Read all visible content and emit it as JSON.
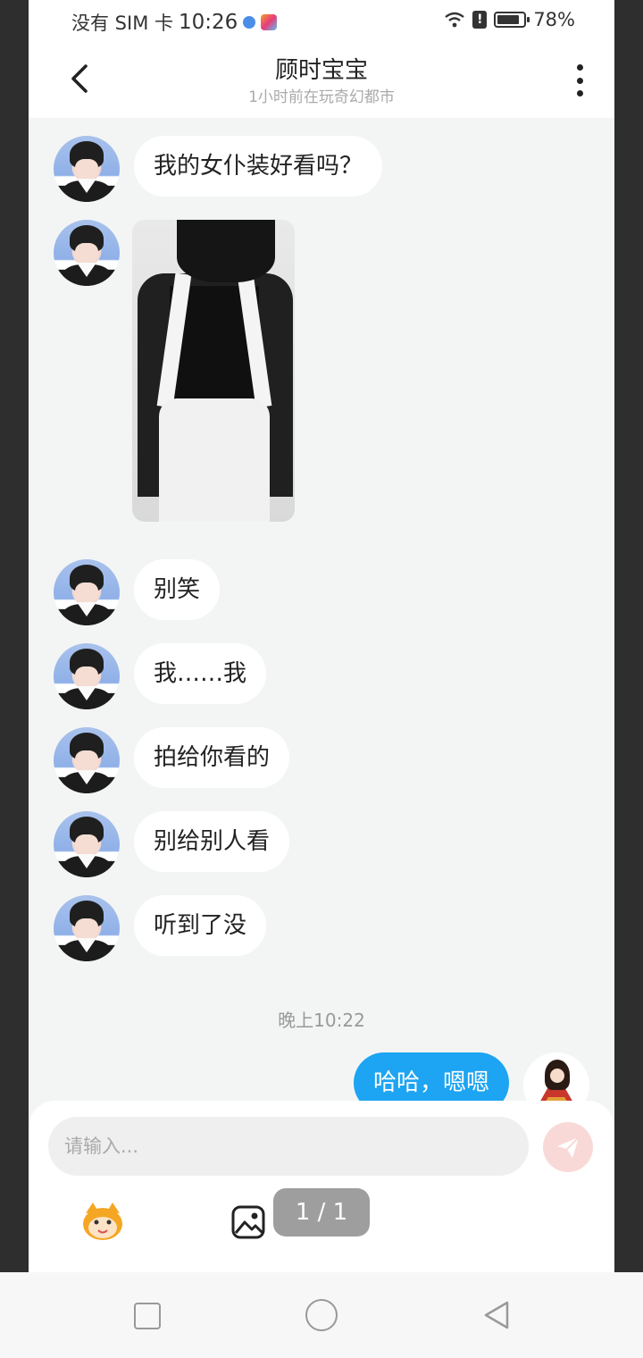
{
  "status_bar": {
    "carrier": "没有 SIM 卡",
    "time": "10:26",
    "battery": "78%"
  },
  "header": {
    "title": "顾时宝宝",
    "subtitle": "1小时前在玩奇幻都市"
  },
  "messages": [
    {
      "from": "other",
      "type": "text",
      "text": "我的女仆装好看吗？"
    },
    {
      "from": "other",
      "type": "image"
    },
    {
      "from": "other",
      "type": "text",
      "text": "别笑"
    },
    {
      "from": "other",
      "type": "text",
      "text": "我……我"
    },
    {
      "from": "other",
      "type": "text",
      "text": "拍给你看的"
    },
    {
      "from": "other",
      "type": "text",
      "text": "别给别人看"
    },
    {
      "from": "other",
      "type": "text",
      "text": "听到了没"
    }
  ],
  "time_label": "晚上10:22",
  "my_message": "哈哈，嗯嗯",
  "input": {
    "placeholder": "请输入..."
  },
  "page_indicator": "1 / 1",
  "colors": {
    "my_bubble": "#1da4f2",
    "send_button": "#f9d9d7",
    "chat_bg": "#f3f5f5"
  },
  "icons": [
    "back-icon",
    "more-icon",
    "send-icon",
    "emoji-icon",
    "image-icon",
    "nav-recent-icon",
    "nav-home-icon",
    "nav-back-icon"
  ]
}
